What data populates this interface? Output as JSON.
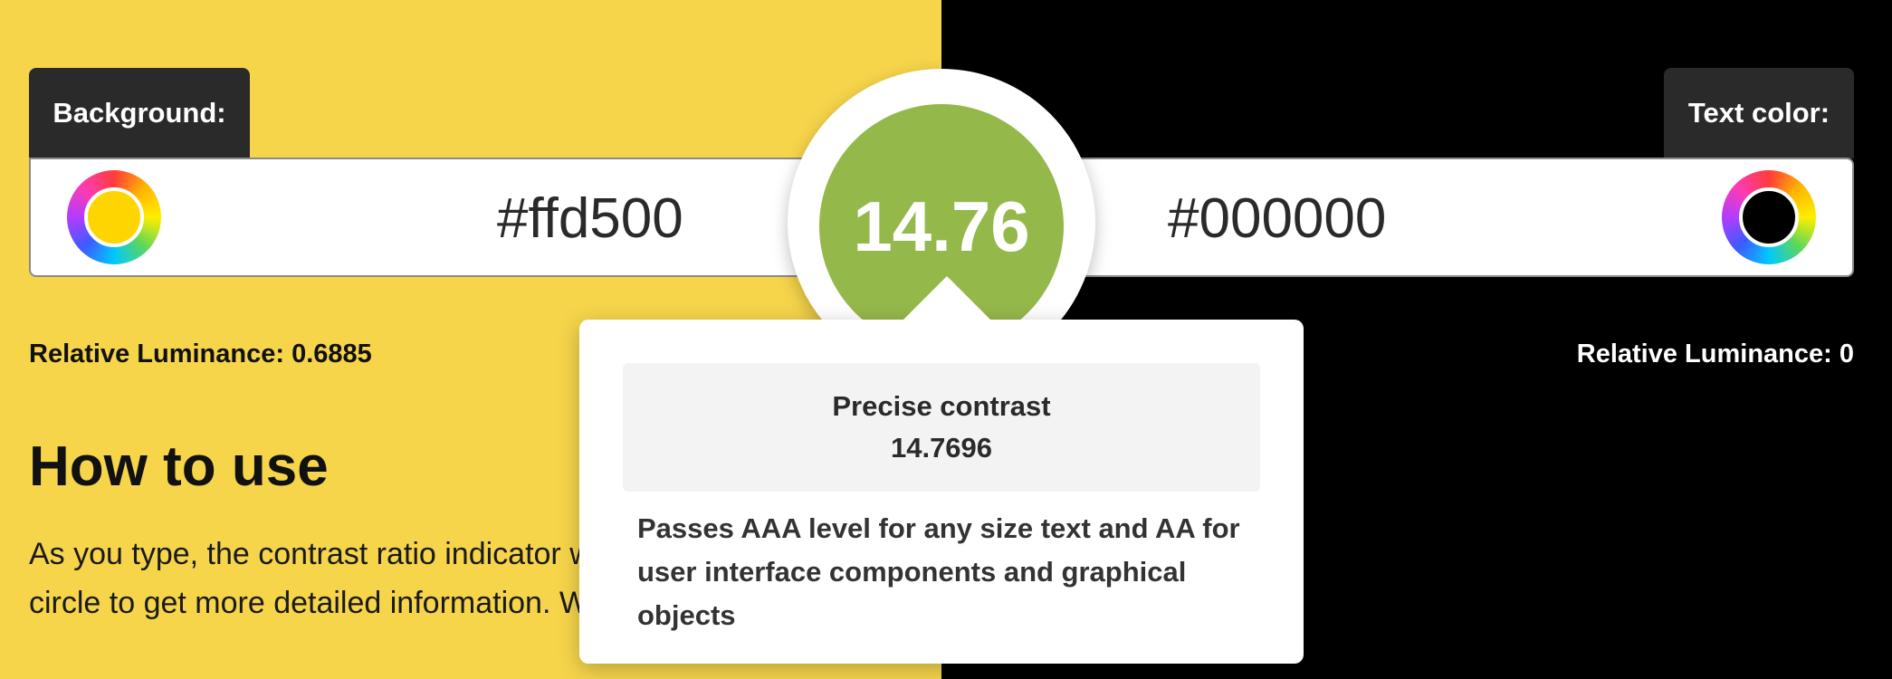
{
  "colors": {
    "background_hex": "#ffd500",
    "text_hex": "#000000",
    "left_panel_color": "#f6d54b",
    "right_panel_color": "#000000",
    "score_circle_color": "#95b84b"
  },
  "background": {
    "label": "Background:",
    "value": "#ffd500",
    "luminance_label": "Relative Luminance:",
    "luminance_value": "0.6885"
  },
  "text_color": {
    "label": "Text color:",
    "value": "#000000",
    "luminance_label": "Relative Luminance:",
    "luminance_value": "0"
  },
  "score": {
    "ratio": "14.76"
  },
  "tooltip": {
    "precise_label": "Precise contrast",
    "precise_value": "14.7696",
    "description": "Passes AAA level for any size text and AA for user interface components and graphical objects"
  },
  "howto": {
    "title": "How to use",
    "text": "As you type, the contrast ratio indicator will update. Hover over the circle to get more detailed information. When semi-transparent"
  },
  "icons": {
    "background_swatch": "color-wheel-icon",
    "text_swatch": "color-wheel-icon"
  }
}
